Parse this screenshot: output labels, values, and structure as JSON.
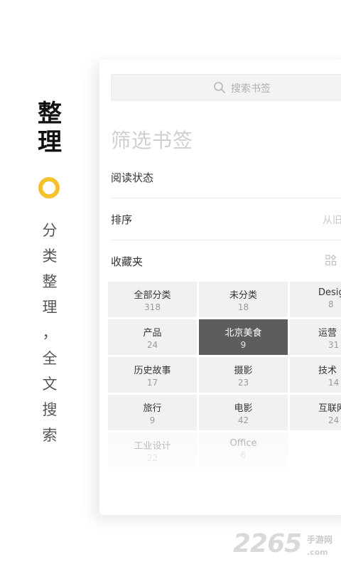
{
  "promo": {
    "title": [
      "整",
      "理"
    ],
    "subtitle": [
      "分",
      "类",
      "整",
      "理",
      "，",
      "全",
      "文",
      "搜",
      "索"
    ],
    "accent_color": "#f5c02a"
  },
  "search": {
    "placeholder": "搜索书签",
    "icon": "search-icon"
  },
  "filter": {
    "title": "筛选书签",
    "rows": [
      {
        "label": "阅读状态",
        "value": ""
      },
      {
        "label": "排序",
        "value": "从旧"
      },
      {
        "label": "收藏夹",
        "value": ""
      }
    ],
    "folder_icon": "grid-icon"
  },
  "folders": [
    {
      "name": "全部分类",
      "count": "318"
    },
    {
      "name": "未分类",
      "count": "18"
    },
    {
      "name": "Desig",
      "count": "8"
    },
    {
      "name": "产品",
      "count": "24"
    },
    {
      "name": "北京美食",
      "count": "9",
      "selected": true
    },
    {
      "name": "运营",
      "count": "31"
    },
    {
      "name": "历史故事",
      "count": "17"
    },
    {
      "name": "摄影",
      "count": "23"
    },
    {
      "name": "技术",
      "count": "14"
    },
    {
      "name": "旅行",
      "count": "9"
    },
    {
      "name": "电影",
      "count": "42"
    },
    {
      "name": "互联网",
      "count": "24"
    },
    {
      "name": "工业设计",
      "count": "22"
    },
    {
      "name": "Office",
      "count": "6"
    }
  ],
  "watermark": {
    "number": "2265",
    "chinese": "手游网",
    "domain": ".com"
  }
}
